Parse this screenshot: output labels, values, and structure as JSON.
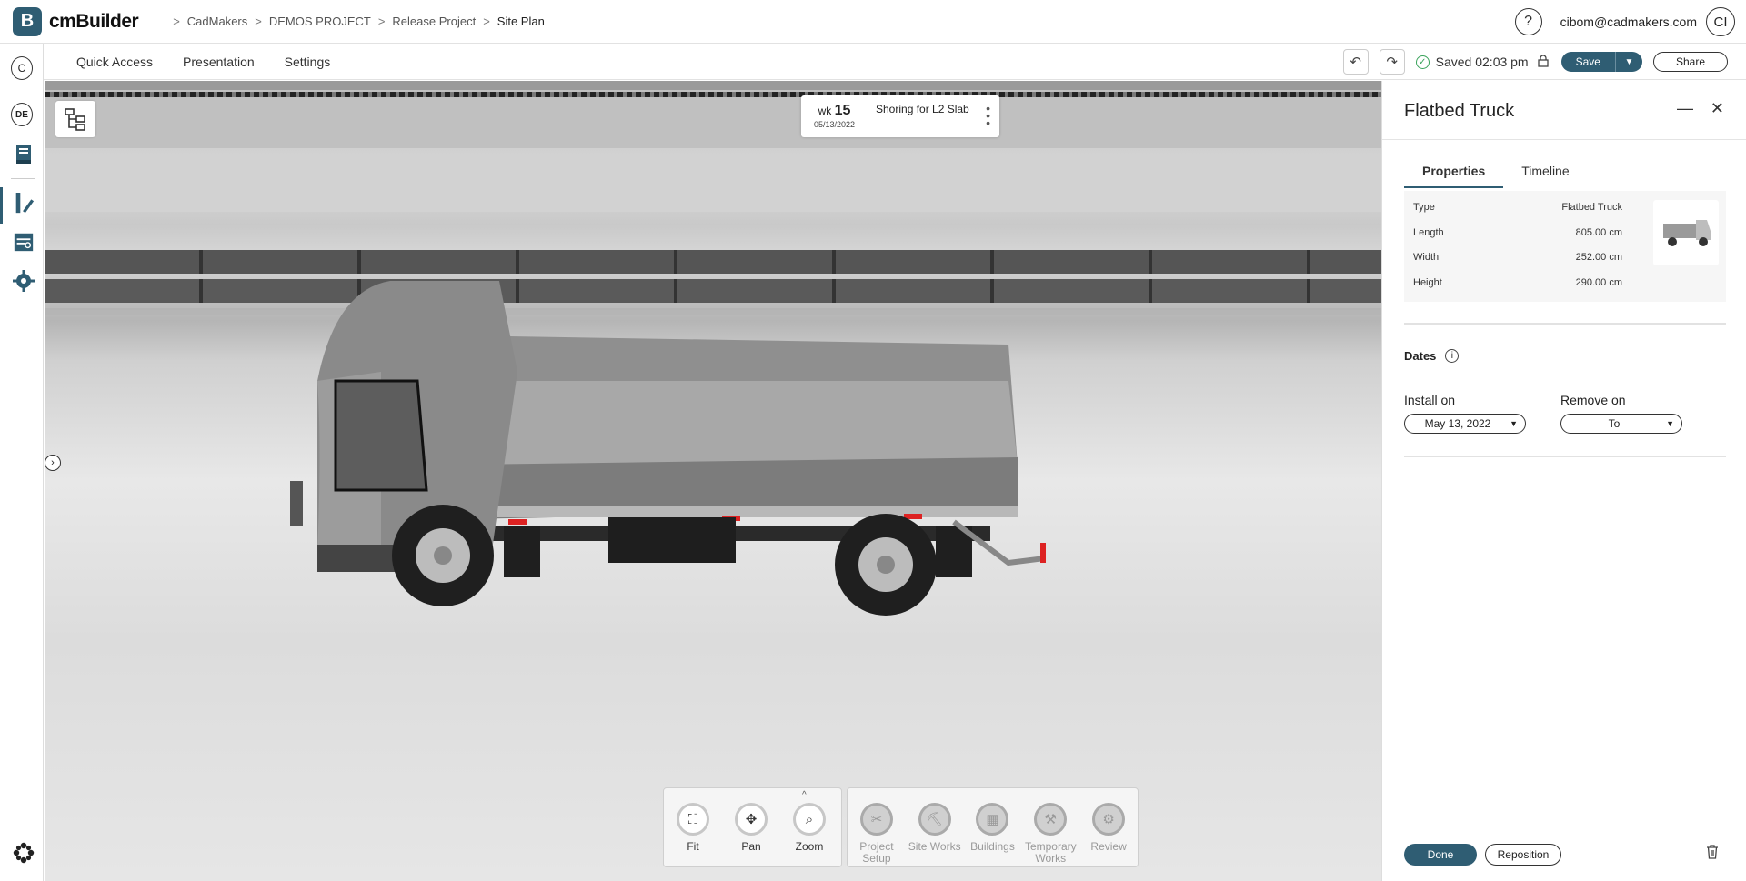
{
  "app": {
    "logo_letter": "B",
    "name": "cmBuilder"
  },
  "breadcrumb": [
    "CadMakers",
    "DEMOS PROJECT",
    "Release Project",
    "Site Plan"
  ],
  "user": {
    "help": "?",
    "email": "cibom@cadmakers.com",
    "initials": "CI"
  },
  "rail": {
    "company_initial": "C",
    "language": "DE"
  },
  "menu": [
    "Quick Access",
    "Presentation",
    "Settings"
  ],
  "toolbar": {
    "saved_text": "Saved 02:03 pm",
    "save_label": "Save",
    "share_label": "Share"
  },
  "week_card": {
    "wk_label": "wk",
    "wk_number": "15",
    "date": "05/13/2022",
    "task": "Shoring for L2 Slab"
  },
  "view_tools": [
    {
      "label": "Fit"
    },
    {
      "label": "Pan"
    },
    {
      "label": "Zoom"
    }
  ],
  "mode_tools": [
    {
      "label": "Project Setup"
    },
    {
      "label": "Site Works"
    },
    {
      "label": "Buildings"
    },
    {
      "label": "Temporary Works"
    },
    {
      "label": "Review"
    }
  ],
  "panel": {
    "title": "Flatbed Truck",
    "tabs": [
      "Properties",
      "Timeline"
    ],
    "properties": [
      {
        "key": "Type",
        "value": "Flatbed Truck"
      },
      {
        "key": "Length",
        "value": "805.00 cm"
      },
      {
        "key": "Width",
        "value": "252.00 cm"
      },
      {
        "key": "Height",
        "value": "290.00 cm"
      }
    ],
    "dates_title": "Dates",
    "install_label": "Install on",
    "install_value": "May 13, 2022",
    "remove_label": "Remove on",
    "remove_value": "To",
    "done_label": "Done",
    "reposition_label": "Reposition"
  },
  "colors": {
    "brand": "#2f5d73",
    "saved_ok": "#3aa35b"
  }
}
